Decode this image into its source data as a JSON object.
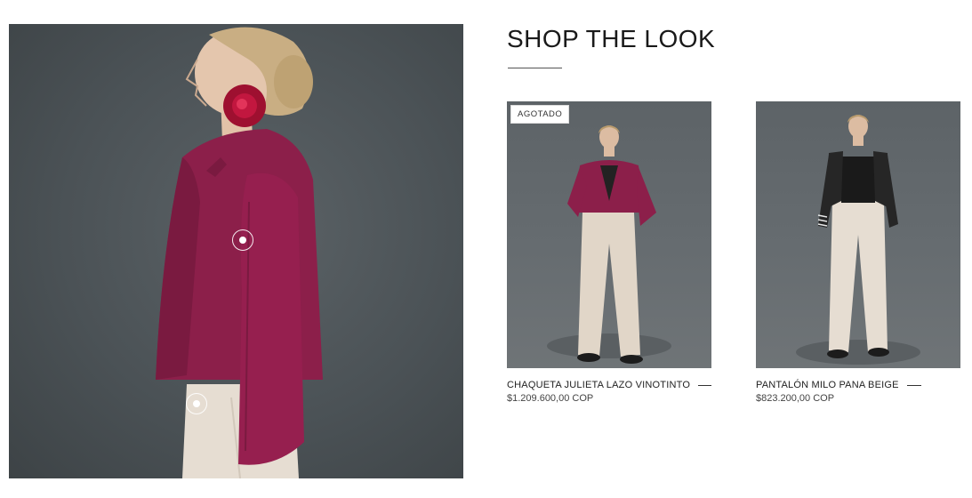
{
  "section": {
    "title": "SHOP THE LOOK"
  },
  "hero": {
    "hotspots": [
      {
        "label": "product-hotspot-jacket"
      },
      {
        "label": "product-hotspot-pants"
      }
    ]
  },
  "products": [
    {
      "badge": "AGOTADO",
      "name": "CHAQUETA JULIETA LAZO VINOTINTO",
      "price": "$1.209.600,00 COP"
    },
    {
      "badge": "",
      "name": "PANTALÓN MILO PANA BEIGE",
      "price": "$823.200,00 COP"
    }
  ],
  "colors": {
    "background": "#ffffff",
    "backdrop": "#4b5256",
    "jacket_burgundy": "#8c1f4a",
    "pants_beige": "#e6ddd2",
    "jacket_black": "#1f1f1f"
  }
}
